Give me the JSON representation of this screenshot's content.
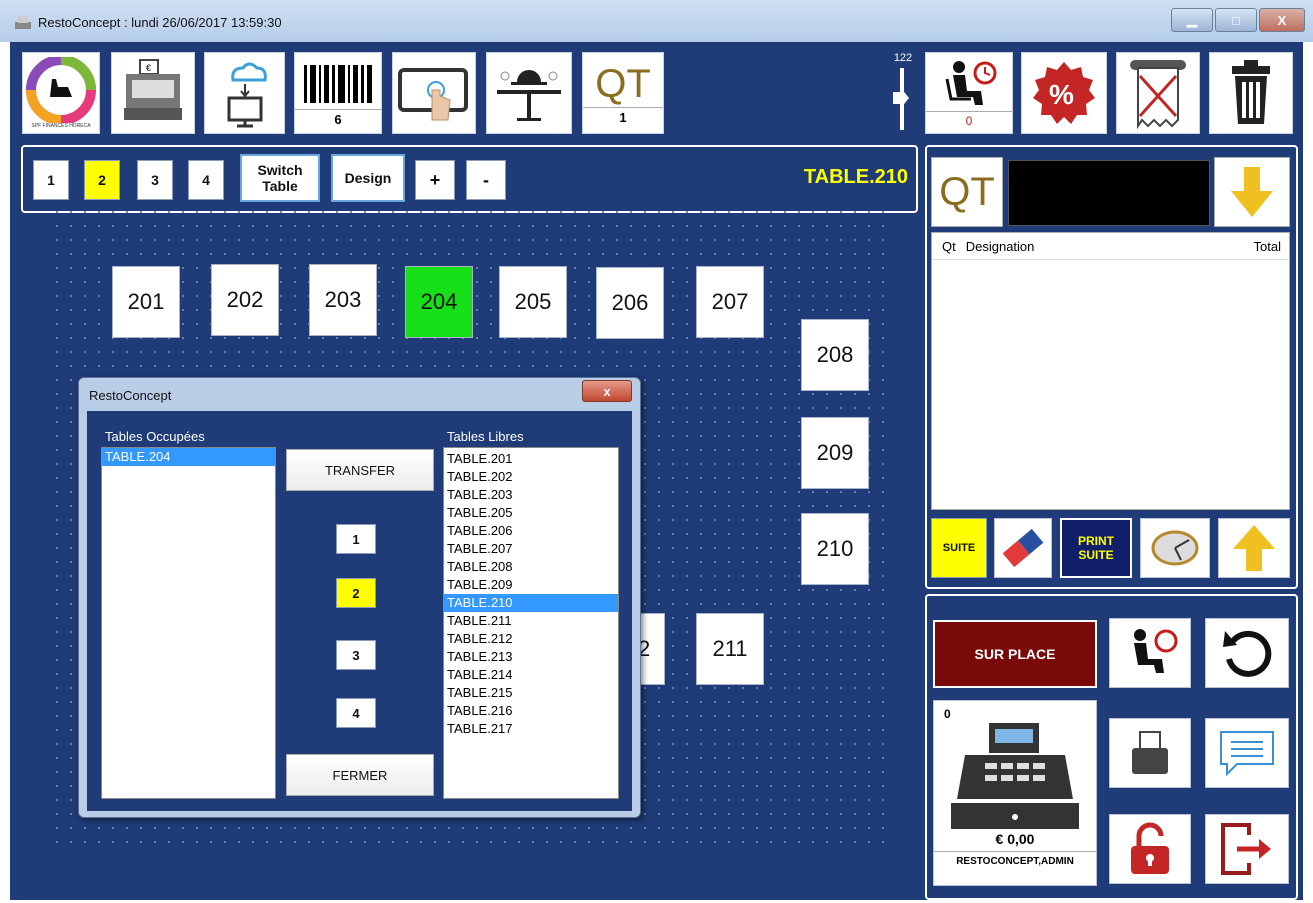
{
  "window": {
    "title": "RestoConcept : lundi 26/06/2017 13:59:30",
    "min": "▁",
    "max": "□",
    "close": "X"
  },
  "toolbar": {
    "logo_caption": "SPF FINANCES HORECA",
    "barcode_count": "6",
    "qt_label": "QT",
    "qt_value": "1",
    "slider_value": "122",
    "waiting_count": "0"
  },
  "room_tabs": [
    "1",
    "2",
    "3",
    "4"
  ],
  "selected_room": "2",
  "switch_table_label": "Switch Table",
  "design_label": "Design",
  "plus_label": "+",
  "minus_label": "-",
  "current_table": "TABLE.210",
  "tables": [
    "201",
    "202",
    "203",
    "204",
    "205",
    "206",
    "207",
    "208",
    "209",
    "210",
    "211"
  ],
  "occupied_table": "204",
  "partial_table_label": "2",
  "dialog": {
    "title": "RestoConcept",
    "close": "x",
    "occupied_label": "Tables Occupées",
    "free_label": "Tables Libres",
    "occupied": [
      "TABLE.204"
    ],
    "free": [
      "TABLE.201",
      "TABLE.202",
      "TABLE.203",
      "TABLE.205",
      "TABLE.206",
      "TABLE.207",
      "TABLE.208",
      "TABLE.209",
      "TABLE.210",
      "TABLE.211",
      "TABLE.212",
      "TABLE.213",
      "TABLE.214",
      "TABLE.215",
      "TABLE.216",
      "TABLE.217"
    ],
    "selected_free": "TABLE.210",
    "transfer": "TRANSFER",
    "rooms": [
      "1",
      "2",
      "3",
      "4"
    ],
    "selected_room": "2",
    "close_button": "FERMER"
  },
  "order": {
    "qt_label": "QT",
    "col_qt": "Qt",
    "col_designation": "Designation",
    "col_total": "Total"
  },
  "actions": {
    "suite": "SUITE",
    "print_suite_line1": "PRINT",
    "print_suite_line2": "SUITE",
    "sur_place": "SUR PLACE"
  },
  "register": {
    "count": "0",
    "amount": "€ 0,00",
    "user": "RESTOCONCEPT,ADMIN"
  },
  "colors": {
    "bg": "#1f3b78",
    "occupied": "#18e018",
    "highlight": "#ffff00",
    "sur_place": "#7a0a0a"
  }
}
